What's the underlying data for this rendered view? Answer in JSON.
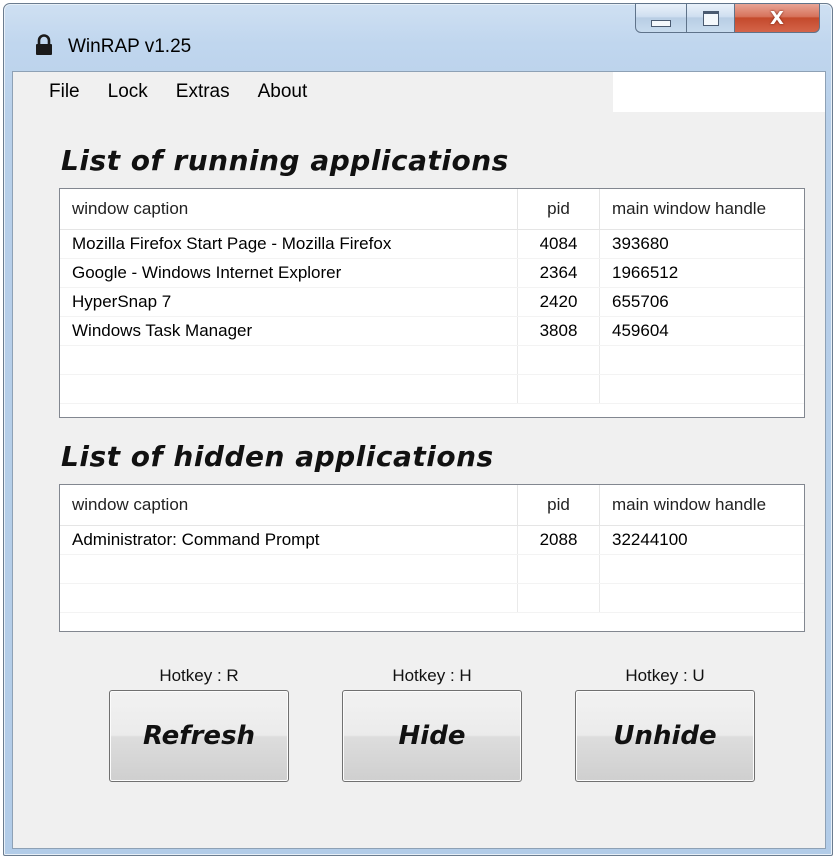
{
  "window": {
    "title": "WinRAP v1.25",
    "close_glyph": "X"
  },
  "menu": {
    "items": [
      "File",
      "Lock",
      "Extras",
      "About"
    ]
  },
  "running": {
    "title": "List of running applications",
    "columns": [
      "window caption",
      "pid",
      "main window handle"
    ],
    "rows": [
      [
        "Mozilla Firefox Start Page - Mozilla Firefox",
        "4084",
        "393680"
      ],
      [
        "Google - Windows Internet Explorer",
        "2364",
        "1966512"
      ],
      [
        "HyperSnap 7",
        "2420",
        "655706"
      ],
      [
        "Windows Task Manager",
        "3808",
        "459604"
      ]
    ]
  },
  "hidden": {
    "title": "List of hidden applications",
    "columns": [
      "window caption",
      "pid",
      "main window handle"
    ],
    "rows": [
      [
        "Administrator: Command Prompt",
        "2088",
        "32244100"
      ]
    ]
  },
  "buttons": [
    {
      "hotkey": "Hotkey : R",
      "label": "Refresh"
    },
    {
      "hotkey": "Hotkey : H",
      "label": "Hide"
    },
    {
      "hotkey": "Hotkey : U",
      "label": "Unhide"
    }
  ],
  "icons": {
    "app": "lock-icon",
    "minimize": "minimize-icon",
    "maximize": "maximize-icon",
    "close": "close-icon"
  },
  "colors": {
    "titlebar": "#c0d6ee",
    "close_button": "#c44a2c",
    "client": "#f0f0f0"
  }
}
